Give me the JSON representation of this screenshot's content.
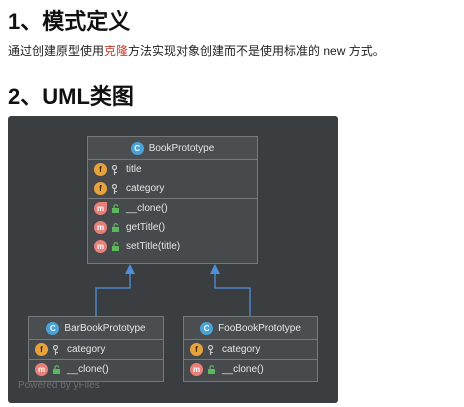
{
  "section1": {
    "heading": "1、模式定义",
    "text_before": "通过创建原型使用",
    "text_highlight": "克隆",
    "text_after": "方法实现对象创建而不是使用标准的 new 方式。"
  },
  "section2": {
    "heading": "2、UML类图"
  },
  "diagram": {
    "background": "#3b3e40",
    "classes": [
      {
        "name": "BookPrototype",
        "icon": "abstract-class-icon",
        "fields": [
          "title",
          "category"
        ],
        "methods": [
          "__clone()",
          "getTitle()",
          "setTitle(title)"
        ]
      },
      {
        "name": "BarBookPrototype",
        "icon": "class-icon",
        "fields": [
          "category"
        ],
        "methods": [
          "__clone()"
        ]
      },
      {
        "name": "FooBookPrototype",
        "icon": "class-icon",
        "fields": [
          "category"
        ],
        "methods": [
          "__clone()"
        ]
      }
    ],
    "badge_letters": {
      "class": "C",
      "field": "f",
      "method": "m"
    },
    "watermark": "Powered by yFiles",
    "arrow_color": "#4f8fd9"
  }
}
